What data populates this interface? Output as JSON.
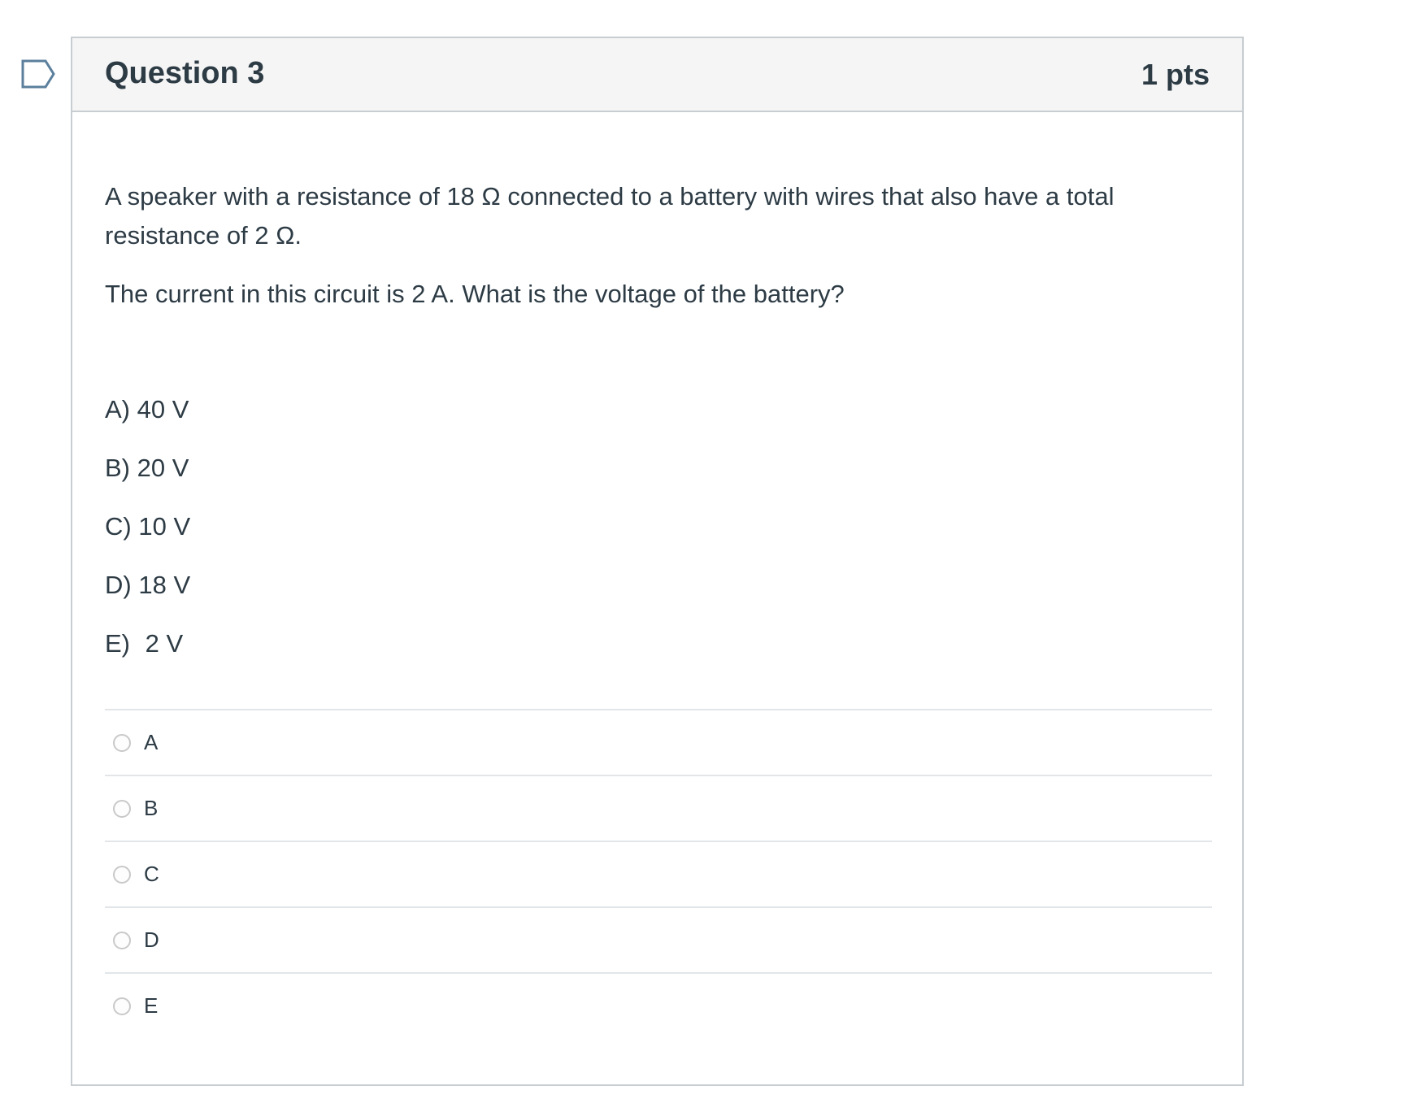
{
  "question": {
    "title": "Question 3",
    "points": "1 pts",
    "text": [
      "A speaker with a resistance of 18 Ω connected to a battery with wires that also have a total resistance of 2 Ω.",
      "The current in this circuit is 2 A. What is the voltage of the battery?"
    ],
    "choices": [
      {
        "letter": "A)",
        "value": "40 V"
      },
      {
        "letter": "B)",
        "value": "20 V"
      },
      {
        "letter": "C)",
        "value": "10 V"
      },
      {
        "letter": "D)",
        "value": "18 V"
      },
      {
        "letter": "E)",
        "value": "2 V"
      }
    ],
    "answers": [
      {
        "label": "A",
        "selected": false
      },
      {
        "label": "B",
        "selected": false
      },
      {
        "label": "C",
        "selected": false
      },
      {
        "label": "D",
        "selected": false
      },
      {
        "label": "E",
        "selected": false
      }
    ]
  },
  "flag": {
    "icon": "bookmark-flag-icon",
    "color": "#5b7f9c"
  },
  "colors": {
    "text": "#2d3b45",
    "header_bg": "#f5f5f5",
    "border": "#c7cdd1"
  }
}
